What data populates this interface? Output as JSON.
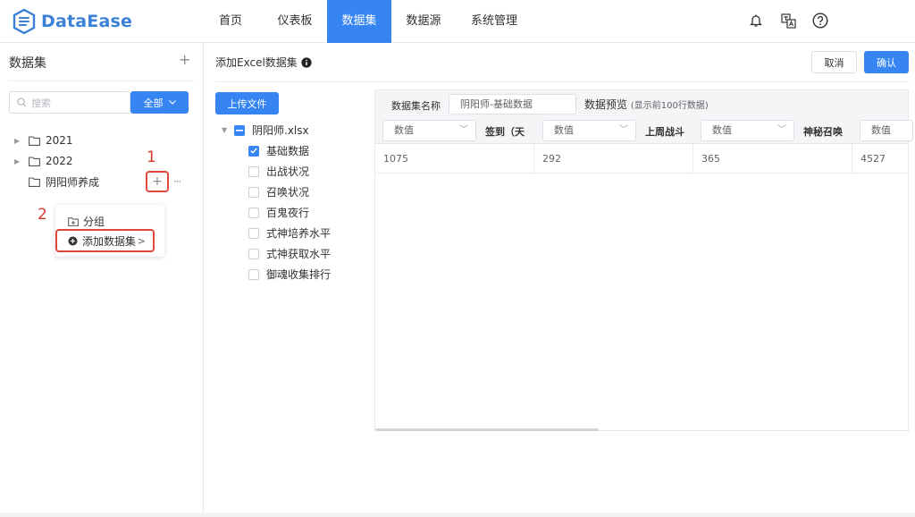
{
  "brand": {
    "name": "DataEase",
    "color": "#3b82d7"
  },
  "nav": {
    "items": [
      "首页",
      "仪表板",
      "数据集",
      "数据源",
      "系统管理"
    ],
    "active_index": 2
  },
  "top_icons": [
    "bell-icon",
    "translate-icon",
    "help-icon"
  ],
  "left": {
    "title": "数据集",
    "search_placeholder": "搜索",
    "filter_label": "全部",
    "tree": [
      {
        "label": "2021",
        "expandable": true
      },
      {
        "label": "2022",
        "expandable": true
      },
      {
        "label": "阴阳师养成",
        "expandable": false
      }
    ],
    "annotation_1": "1",
    "annotation_2": "2",
    "popup": {
      "item_group": "分组",
      "item_add": "添加数据集"
    }
  },
  "main": {
    "title": "添加Excel数据集",
    "cancel": "取消",
    "confirm": "确认",
    "upload": "上传文件",
    "file_name": "阴阳师.xlsx",
    "sheets": [
      {
        "label": "基础数据",
        "checked": true
      },
      {
        "label": "出战状况",
        "checked": false
      },
      {
        "label": "召唤状况",
        "checked": false
      },
      {
        "label": "百鬼夜行",
        "checked": false
      },
      {
        "label": "式神培养水平",
        "checked": false
      },
      {
        "label": "式神获取水平",
        "checked": false
      },
      {
        "label": "御魂收集排行",
        "checked": false
      }
    ],
    "preview": {
      "name_label": "数据集名称",
      "name_value": "阴阳师-基础数据",
      "title": "数据预览",
      "subtitle": "(显示前100行数据)",
      "columns": [
        {
          "type": "数值",
          "name": "签到（天",
          "value": "1075"
        },
        {
          "type": "数值",
          "name": "上周战斗",
          "value": "292"
        },
        {
          "type": "数值",
          "name": "神秘召唤",
          "value": "365"
        },
        {
          "type": "数值",
          "name": "",
          "value": "4527"
        }
      ]
    }
  },
  "colors": {
    "primary": "#3685f2",
    "annotation": "#e0473c"
  }
}
